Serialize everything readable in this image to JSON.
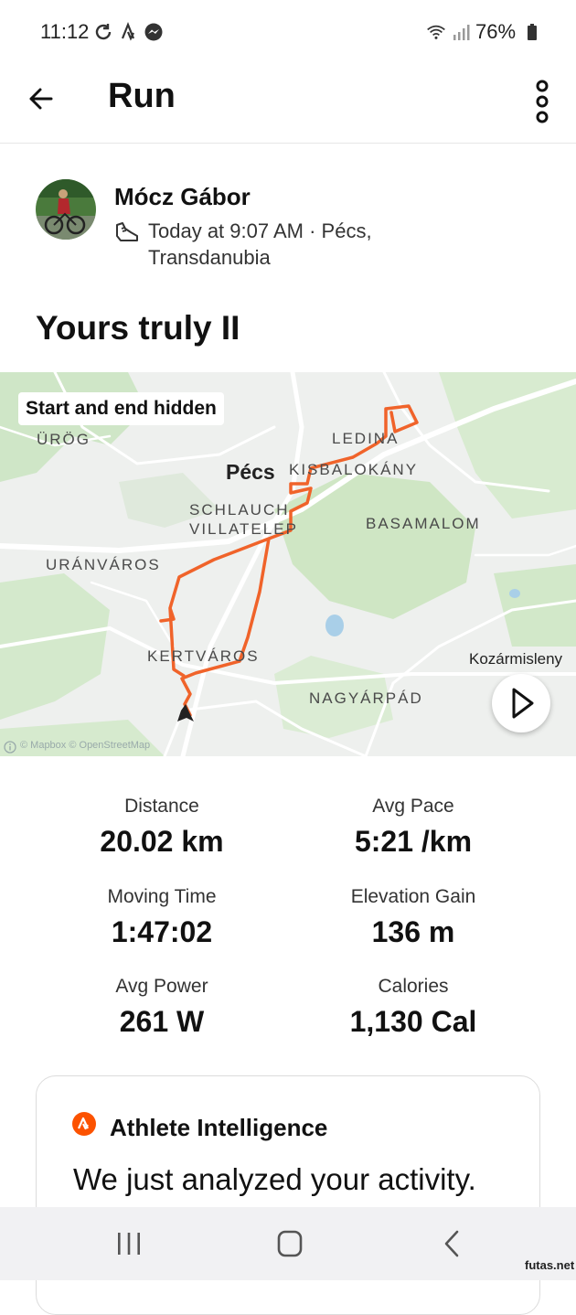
{
  "status_bar": {
    "time": "11:12",
    "battery": "76%",
    "icons": [
      "sync-icon",
      "strava-icon",
      "messenger-icon",
      "wifi-icon",
      "signal-icon",
      "battery-icon"
    ]
  },
  "app_bar": {
    "title": "Run",
    "back_icon": "arrow-left-icon",
    "more_icon": "more-vertical-icon"
  },
  "athlete": {
    "name": "Mócz Gábor",
    "meta_line1": "Today at 9:07 AM · Pécs,",
    "meta_line2": "Transdanubia",
    "activity_icon": "running-shoe-icon"
  },
  "activity_title": "Yours truly II",
  "map": {
    "privacy_badge": "Start and end hidden",
    "labels": {
      "urog": "ÜRÖG",
      "ledina": "LEDINA",
      "pecs": "Pécs",
      "kisbalokany": "KISBALOKÁNY",
      "schlauch": "SCHLAUCH",
      "villatelep": "VILLATELEP",
      "basamalom": "BASAMALOM",
      "uranvaros": "URÁNVÁROS",
      "kertvaros": "KERTVÁROS",
      "kozarmisleny": "Kozármisleny",
      "nagyarpad": "NAGYÁRPÁD"
    },
    "attribution": "© Mapbox © OpenStreetMap",
    "route_color": "#f0632a",
    "play_icon": "play-icon"
  },
  "stats": [
    {
      "label": "Distance",
      "value": "20.02 km"
    },
    {
      "label": "Avg Pace",
      "value": "5:21 /km"
    },
    {
      "label": "Moving Time",
      "value": "1:47:02"
    },
    {
      "label": "Elevation Gain",
      "value": "136 m"
    },
    {
      "label": "Avg Power",
      "value": "261 W"
    },
    {
      "label": "Calories",
      "value": "1,130 Cal"
    }
  ],
  "athlete_intelligence": {
    "title": "Athlete Intelligence",
    "body": "We just analyzed your activity. Want to see your insights?",
    "icon": "strava-logo-icon",
    "accent": "#fc5200"
  },
  "nav_bar": {
    "icons": [
      "recent-apps-icon",
      "home-icon",
      "back-chevron-icon"
    ]
  },
  "watermark": "futas.net"
}
